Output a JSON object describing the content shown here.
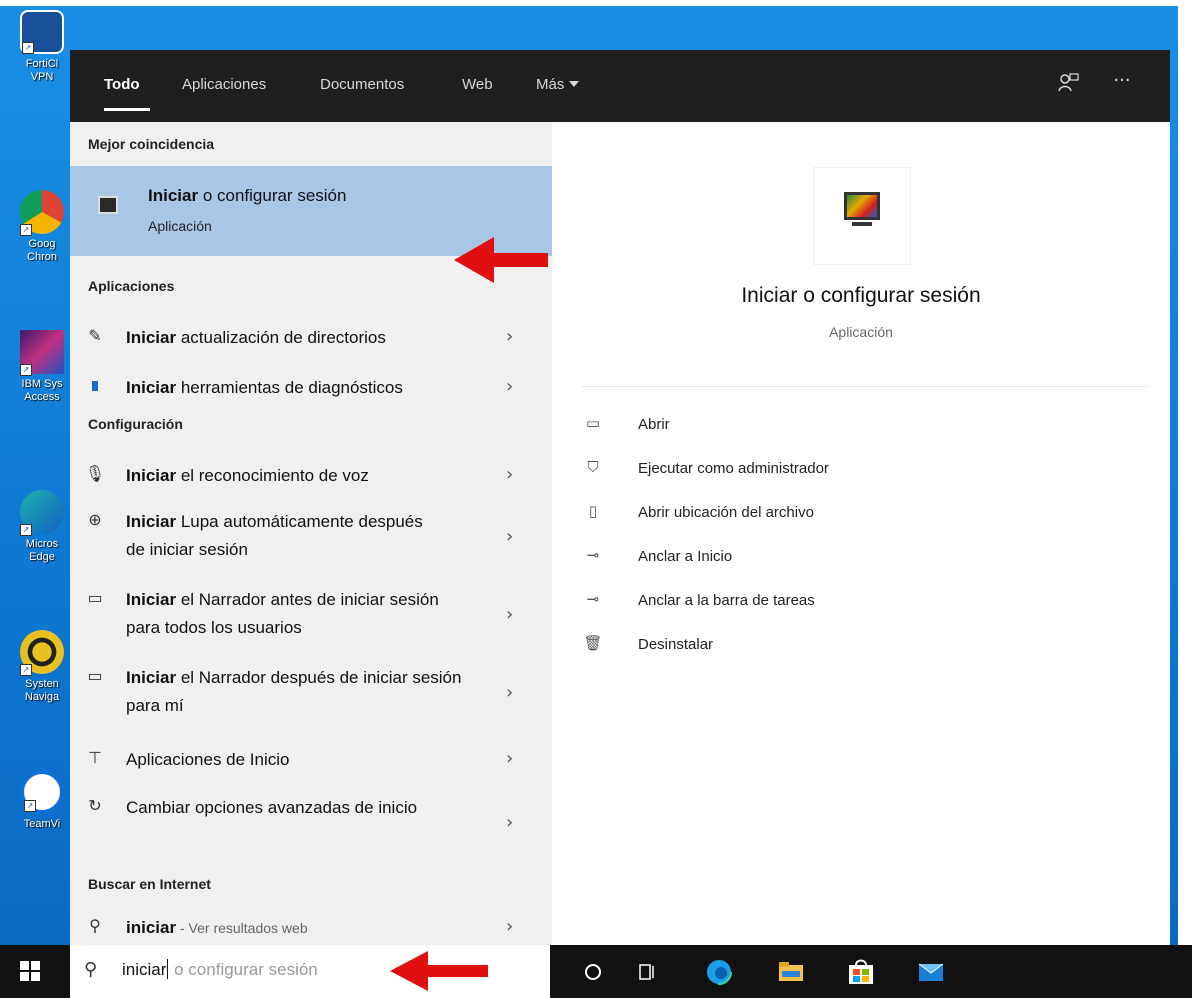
{
  "desktop": {
    "icons": [
      {
        "label": "FortiCl\nVPN"
      },
      {
        "label": "Goog\nChron"
      },
      {
        "label": "IBM Sys\nAccess"
      },
      {
        "label": "Micros\nEdge"
      },
      {
        "label": "Systen\nNaviga"
      },
      {
        "label": "TeamVi"
      }
    ]
  },
  "tabs": {
    "todo": "Todo",
    "aplicaciones": "Aplicaciones",
    "documentos": "Documentos",
    "web": "Web",
    "mas": "Más",
    "more_icon": "···"
  },
  "left": {
    "best_match_header": "Mejor coincidencia",
    "best_match": {
      "bold": "Iniciar",
      "rest": " o configurar sesión",
      "subtitle": "Aplicación"
    },
    "apps_header": "Aplicaciones",
    "apps": [
      {
        "bold": "Iniciar",
        "rest": " actualización de directorios"
      },
      {
        "bold": "Iniciar",
        "rest": " herramientas de diagnósticos"
      }
    ],
    "settings_header": "Configuración",
    "settings": [
      {
        "bold": "Iniciar",
        "rest": " el reconocimiento de voz"
      },
      {
        "bold": "Iniciar",
        "rest": " Lupa automáticamente después de iniciar sesión"
      },
      {
        "bold": "Iniciar",
        "rest": " el Narrador antes de iniciar sesión para todos los usuarios"
      },
      {
        "bold": "Iniciar",
        "rest": " el Narrador después de iniciar sesión para mí"
      },
      {
        "bold": "",
        "rest": "Aplicaciones de Inicio"
      },
      {
        "bold": "",
        "rest": "Cambiar opciones avanzadas de inicio"
      }
    ],
    "web_header": "Buscar en Internet",
    "web_result": {
      "bold": "iniciar",
      "rest": " - Ver resultados web"
    }
  },
  "right": {
    "title": "Iniciar o configurar sesión",
    "subtitle": "Aplicación",
    "actions": [
      "Abrir",
      "Ejecutar como administrador",
      "Abrir ubicación del archivo",
      "Anclar a Inicio",
      "Anclar a la barra de tareas",
      "Desinstalar"
    ]
  },
  "taskbar": {
    "search_typed": "iniciar",
    "search_suggestion": " o configurar sesión"
  },
  "colors": {
    "highlight": "#a8c7e7",
    "arrow": "#e01010",
    "tabbar": "#1f1f1f"
  }
}
